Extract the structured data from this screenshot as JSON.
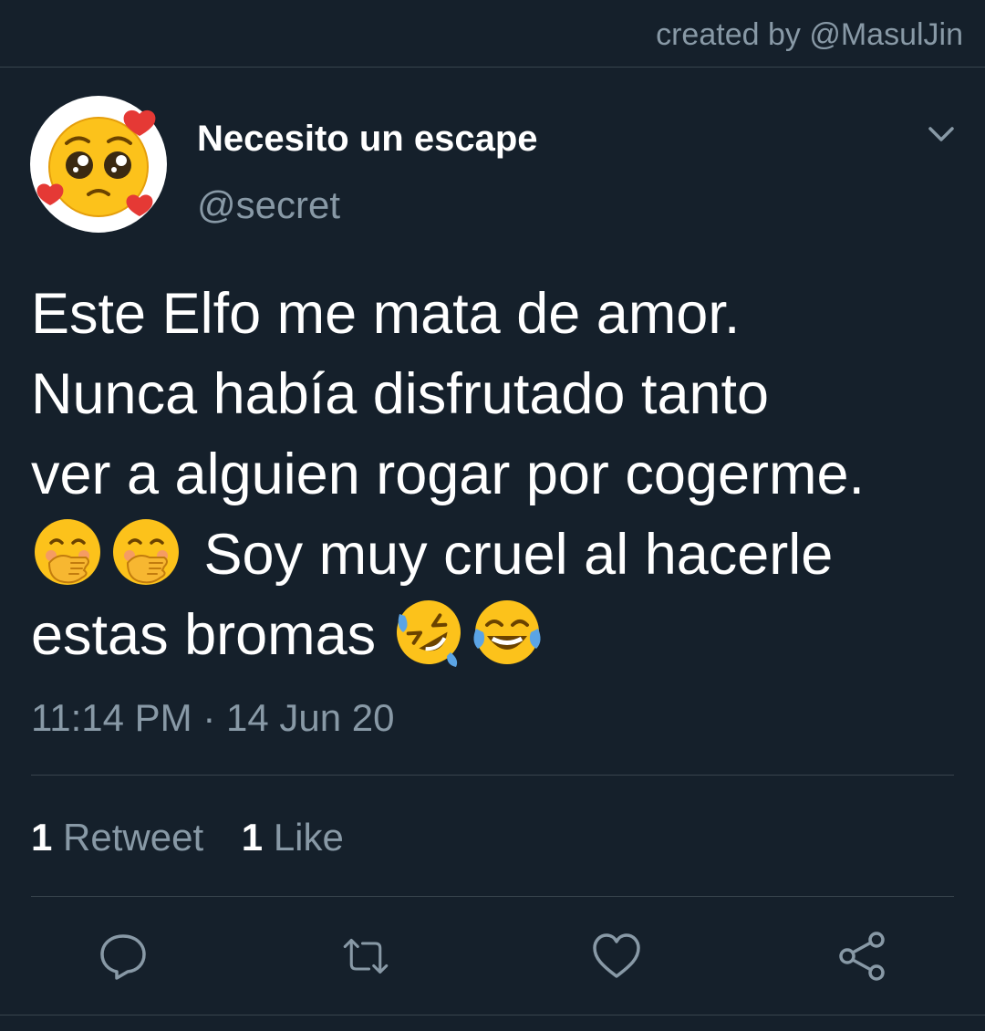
{
  "credit": "created by @MasulJin",
  "user": {
    "display_name": "Necesito un escape",
    "handle": "@secret",
    "avatar_icon": "pleading-face-with-hearts-emoji"
  },
  "tweet": {
    "line1": "Este Elfo me mata de amor.",
    "line2": "Nunca había disfrutado tanto",
    "line3": "ver a alguien rogar por cogerme.",
    "line4": "Soy muy cruel al hacerle",
    "line5": "estas bromas",
    "emojis_line4": [
      "face-with-hand-over-mouth-emoji",
      "face-with-hand-over-mouth-emoji"
    ],
    "emojis_line5": [
      "rolling-on-floor-laughing-emoji",
      "face-with-tears-of-joy-emoji"
    ]
  },
  "timestamp": "11:14 PM · 14 Jun 20",
  "stats": {
    "retweet_count": "1",
    "retweet_label": "Retweet",
    "like_count": "1",
    "like_label": "Like"
  },
  "actions": [
    "reply-icon",
    "retweet-icon",
    "like-icon",
    "share-icon"
  ],
  "colors": {
    "background": "#15202b",
    "text": "#ffffff",
    "secondary_text": "#8899a6",
    "divider": "#38444d"
  }
}
